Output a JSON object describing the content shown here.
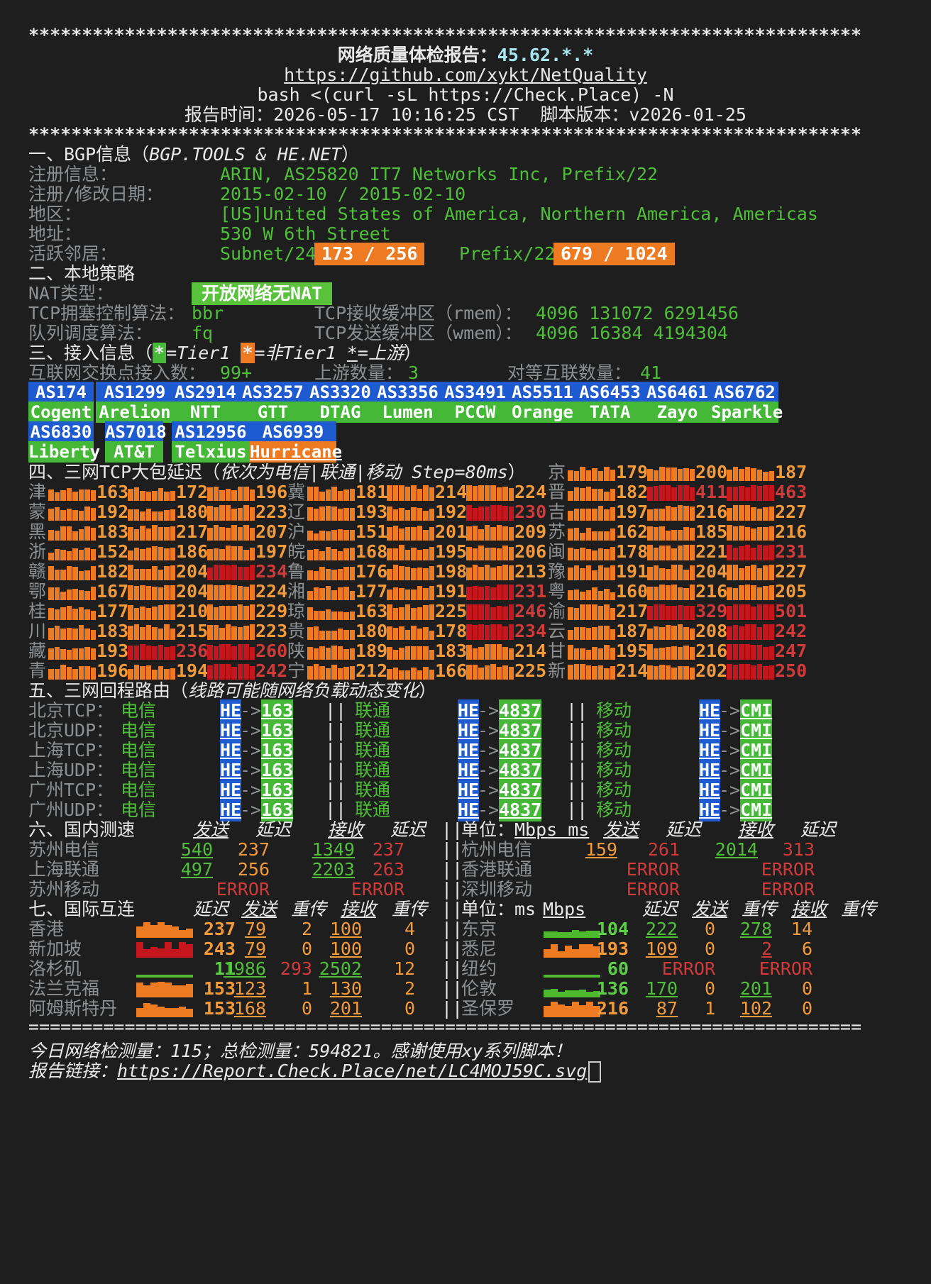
{
  "header": {
    "stars": "******************************************************************************",
    "title_label": "网络质量体检报告：",
    "title_ip": "45.62.*.*",
    "repo_url": "https://github.com/xykt/NetQuality",
    "command": "bash <(curl -sL https://Check.Place) -N",
    "report_time_label": "报告时间：",
    "report_time": "2026-05-17 10:16:25 CST",
    "version_label": "脚本版本：",
    "version": "v2026-01-25"
  },
  "bgp": {
    "title": "一、BGP信息（",
    "title_src": "BGP.TOOLS & HE.NET",
    "title_end": "）",
    "reg_label": "注册信息：",
    "reg": "ARIN, AS25820 IT7 Networks Inc, Prefix/22",
    "date_label": "注册/修改日期：",
    "date": "2015-02-10 / 2015-02-10",
    "region_label": "地区：",
    "region": "[US]United States of America, Northern America, Americas",
    "addr_label": "地址：",
    "addr": "530 W 6th Street",
    "neighbor_label": "活跃邻居：",
    "subnet_label": "Subnet/24",
    "subnet_val": "173 / 256",
    "prefix_label": "Prefix/22",
    "prefix_val": "679 / 1024"
  },
  "local": {
    "title": "二、本地策略",
    "nat_label": "NAT类型：",
    "nat": "开放网络无NAT",
    "cc_label": "TCP拥塞控制算法：",
    "cc": "bbr",
    "rmem_label": "TCP接收缓冲区（rmem）：",
    "rmem": "4096 131072 6291456",
    "qdisc_label": "队列调度算法：",
    "qdisc": "fq",
    "wmem_label": "TCP发送缓冲区（wmem）：",
    "wmem": "4096 16384 4194304"
  },
  "access": {
    "title": "三、接入信息（",
    "legend_star": "*",
    "legend_t1": "=Tier1 ",
    "legend_nt1": "=非Tier1 ",
    "legend_up": "=上游",
    "title_end": "）",
    "ix_label": "互联网交换点接入数：",
    "ix": "99+",
    "up_label": "上游数量：",
    "up": "3",
    "peer_label": "对等互联数量：",
    "peer": "41",
    "asn": [
      {
        "as": "AS174",
        "name": "Cogent"
      },
      {
        "as": "AS1299",
        "name": "Arelion"
      },
      {
        "as": "AS2914",
        "name": "NTT"
      },
      {
        "as": "AS3257",
        "name": "GTT"
      },
      {
        "as": "AS3320",
        "name": "DTAG"
      },
      {
        "as": "AS3356",
        "name": "Lumen"
      },
      {
        "as": "AS3491",
        "name": "PCCW"
      },
      {
        "as": "AS5511",
        "name": "Orange"
      },
      {
        "as": "AS6453",
        "name": "TATA"
      },
      {
        "as": "AS6461",
        "name": "Zayo"
      },
      {
        "as": "AS6762",
        "name": "Sparkle"
      },
      {
        "as": "AS6830",
        "name": "Liberty"
      },
      {
        "as": "AS7018",
        "name": "AT&T"
      },
      {
        "as": "AS12956",
        "name": "Telxius"
      },
      {
        "as": "AS6939",
        "name": "Hurricane"
      }
    ]
  },
  "latency": {
    "title": "四、三网TCP大包延迟（",
    "title_note": "依次为电信|联通|移动 Step=80ms",
    "title_end": "）",
    "rows": [
      [
        "津",
        163,
        172,
        196
      ],
      [
        "冀",
        181,
        214,
        224
      ],
      [
        "晋",
        182,
        411,
        463
      ],
      [
        "蒙",
        192,
        180,
        223
      ],
      [
        "辽",
        193,
        192,
        230
      ],
      [
        "吉",
        197,
        216,
        227
      ],
      [
        "黑",
        183,
        217,
        207
      ],
      [
        "沪",
        151,
        201,
        209
      ],
      [
        "苏",
        162,
        185,
        216
      ],
      [
        "浙",
        152,
        186,
        197
      ],
      [
        "皖",
        168,
        195,
        206
      ],
      [
        "闽",
        178,
        221,
        231
      ],
      [
        "赣",
        182,
        204,
        234
      ],
      [
        "鲁",
        176,
        198,
        213
      ],
      [
        "豫",
        191,
        204,
        227
      ],
      [
        "鄂",
        167,
        204,
        224
      ],
      [
        "湘",
        177,
        191,
        231
      ],
      [
        "粤",
        160,
        216,
        205
      ],
      [
        "桂",
        177,
        210,
        229
      ],
      [
        "琼",
        163,
        225,
        246
      ],
      [
        "渝",
        217,
        329,
        501
      ],
      [
        "川",
        183,
        215,
        223
      ],
      [
        "贵",
        180,
        178,
        234
      ],
      [
        "云",
        187,
        208,
        242
      ],
      [
        "藏",
        193,
        236,
        260
      ],
      [
        "陕",
        189,
        183,
        214
      ],
      [
        "甘",
        195,
        216,
        247
      ],
      [
        "青",
        196,
        194,
        242
      ],
      [
        "宁",
        212,
        166,
        225
      ],
      [
        "新",
        214,
        202,
        250
      ]
    ],
    "beijing": [
      "京",
      179,
      200,
      187
    ]
  },
  "route": {
    "title": "五、三网回程路由（",
    "title_note": "线路可能随网络负载动态变化",
    "title_end": "）",
    "sep": "||",
    "arrow": "->",
    "he": "HE",
    "rows": [
      {
        "label": "北京TCP：",
        "ct": "电信",
        "ct_as": "163",
        "cu": "联通",
        "cu_as": "4837",
        "cm": "移动",
        "cm_as": "CMI"
      },
      {
        "label": "北京UDP：",
        "ct": "电信",
        "ct_as": "163",
        "cu": "联通",
        "cu_as": "4837",
        "cm": "移动",
        "cm_as": "CMI"
      },
      {
        "label": "上海TCP：",
        "ct": "电信",
        "ct_as": "163",
        "cu": "联通",
        "cu_as": "4837",
        "cm": "移动",
        "cm_as": "CMI"
      },
      {
        "label": "上海UDP：",
        "ct": "电信",
        "ct_as": "163",
        "cu": "联通",
        "cu_as": "4837",
        "cm": "移动",
        "cm_as": "CMI"
      },
      {
        "label": "广州TCP：",
        "ct": "电信",
        "ct_as": "163",
        "cu": "联通",
        "cu_as": "4837",
        "cm": "移动",
        "cm_as": "CMI"
      },
      {
        "label": "广州UDP：",
        "ct": "电信",
        "ct_as": "163",
        "cu": "联通",
        "cu_as": "4837",
        "cm": "移动",
        "cm_as": "CMI"
      }
    ]
  },
  "speed": {
    "title": "六、国内测速",
    "h_send": "发送",
    "h_lat": "延迟",
    "h_recv": "接收",
    "h_lat2": "延迟",
    "unit_label": "单位：",
    "unit": "Mbps ms",
    "sep": "||",
    "rows": [
      {
        "l": "苏州电信",
        "s": "540",
        "sl": "237",
        "r": "1349",
        "rl": "237",
        "l2": "杭州电信",
        "s2": "159",
        "sl2": "261",
        "r2": "2014",
        "rl2": "313"
      },
      {
        "l": "上海联通",
        "s": "497",
        "sl": "256",
        "r": "2203",
        "rl": "263",
        "l2": "香港联通",
        "s2": "",
        "sl2": "ERROR",
        "r2": "",
        "rl2": "ERROR"
      },
      {
        "l": "苏州移动",
        "s": "",
        "sl": "ERROR",
        "r": "",
        "rl": "ERROR",
        "l2": "深圳移动",
        "s2": "",
        "sl2": "ERROR",
        "r2": "",
        "rl2": "ERROR"
      }
    ]
  },
  "intl": {
    "title": "七、国际互连",
    "h_lat": "延迟",
    "h_send": "发送",
    "h_re": "重传",
    "h_recv": "接收",
    "h_re2": "重传",
    "unit_label": "单位：",
    "unit_ms": "ms",
    "unit_mbps": "Mbps",
    "sep": "||",
    "rows": [
      {
        "l": "香港",
        "lat": "237",
        "s": "79",
        "re": "2",
        "r": "100",
        "re2": "4",
        "l2": "东京",
        "lat2": "104",
        "s2": "222",
        "re3": "0",
        "r2": "278",
        "re4": "14"
      },
      {
        "l": "新加坡",
        "lat": "243",
        "s": "79",
        "re": "0",
        "r": "100",
        "re2": "0",
        "l2": "悉尼",
        "lat2": "193",
        "s2": "109",
        "re3": "0",
        "r2": "2",
        "re4": "6"
      },
      {
        "l": "洛杉矶",
        "lat": "11",
        "s": "1986",
        "re": "293",
        "r": "2502",
        "re2": "12",
        "l2": "纽约",
        "lat2": "60",
        "s2": "",
        "re3": "ERROR",
        "r2": "",
        "re4": "ERROR"
      },
      {
        "l": "法兰克福",
        "lat": "153",
        "s": "123",
        "re": "1",
        "r": "130",
        "re2": "2",
        "l2": "伦敦",
        "lat2": "136",
        "s2": "170",
        "re3": "0",
        "r2": "201",
        "re4": "0"
      },
      {
        "l": "阿姆斯特丹",
        "lat": "153",
        "s": "168",
        "re": "0",
        "r": "201",
        "re2": "0",
        "l2": "圣保罗",
        "lat2": "216",
        "s2": "87",
        "re3": "1",
        "r2": "102",
        "re4": "0"
      }
    ]
  },
  "footer": {
    "eq": "==============================================================================",
    "stats": "今日网络检测量：115；总检测量：594821。感谢使用xy系列脚本！",
    "link_label": "报告链接：",
    "link": "https://Report.Check.Place/net/LC4MOJ59C.svg"
  }
}
